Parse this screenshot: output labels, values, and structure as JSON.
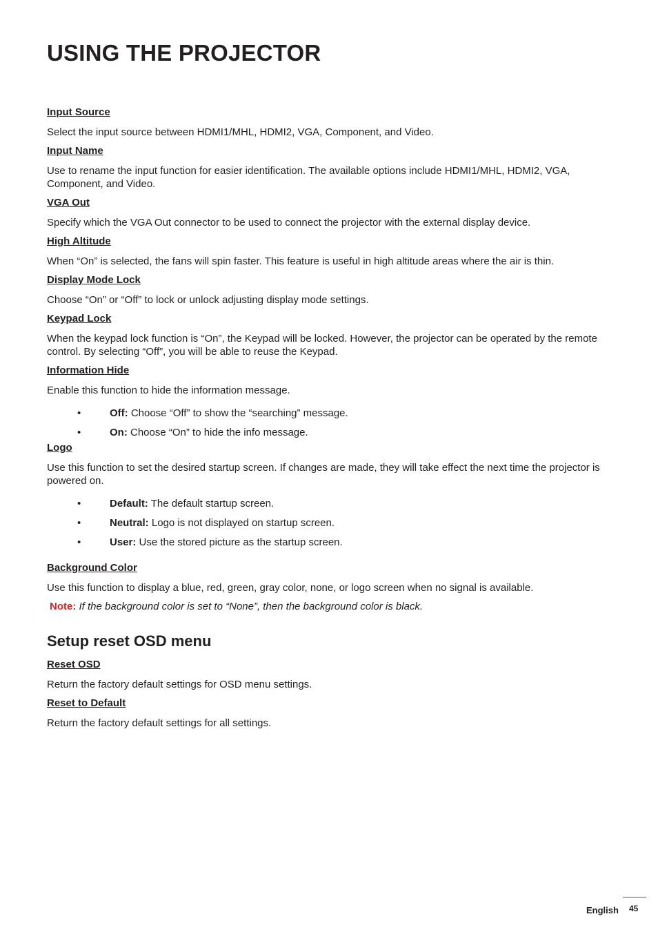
{
  "page": {
    "title": "USING THE PROJECTOR"
  },
  "items": [
    {
      "heading": "Input Source",
      "text": "Select  the input source between HDMI1/MHL, HDMI2, VGA, Component, and Video."
    },
    {
      "heading": "Input Name",
      "text": "Use to rename the input function for easier identification. The available options include HDMI1/MHL, HDMI2, VGA, Component, and Video."
    },
    {
      "heading": "VGA Out",
      "text": "Specify which the VGA Out connector to be used to connect the projector with the external display device."
    },
    {
      "heading": "High Altitude",
      "text": "When “On” is selected, the fans will spin faster. This feature is useful in high altitude areas where the air is thin."
    },
    {
      "heading": "Display Mode Lock",
      "text": "Choose “On” or “Off” to lock or unlock adjusting display mode settings."
    },
    {
      "heading": "Keypad Lock",
      "text": "When the keypad lock function is “On”, the Keypad will be locked. However, the projector can be operated by the remote control. By selecting “Off”, you will be able to reuse the Keypad."
    },
    {
      "heading": "Information Hide",
      "text": "Enable this function to hide the information message.",
      "bullets": [
        {
          "term": "Off:",
          "desc": " Choose “Off” to show the “searching” message."
        },
        {
          "term": "On:",
          "desc": " Choose “On” to hide the info message."
        }
      ]
    },
    {
      "heading": "Logo",
      "text": "Use this function to set the desired startup screen. If changes are made, they will take effect the next time the projector is powered on.",
      "bullets": [
        {
          "term": "Default:",
          "desc": " The default startup screen."
        },
        {
          "term": "Neutral:",
          "desc": " Logo is not displayed on startup screen."
        },
        {
          "term": "User:",
          "desc": " Use the stored picture as the startup screen."
        }
      ]
    },
    {
      "heading": "Background Color",
      "text": "Use this function to display a blue, red, green, gray color, none, or logo screen when no signal is available.",
      "note_label": "Note:",
      "note_text": " If the background color is set to “None”, then the background color is black."
    }
  ],
  "reset_section": {
    "title": "Setup reset OSD menu",
    "items": [
      {
        "heading": "Reset OSD",
        "text": "Return the factory default settings for OSD menu settings."
      },
      {
        "heading": "Reset to Default",
        "text": "Return the factory default settings for all settings."
      }
    ]
  },
  "footer": {
    "language": "English",
    "page_number": "45",
    "accent_color": "#d2232a"
  },
  "bullet_glyph": "•"
}
